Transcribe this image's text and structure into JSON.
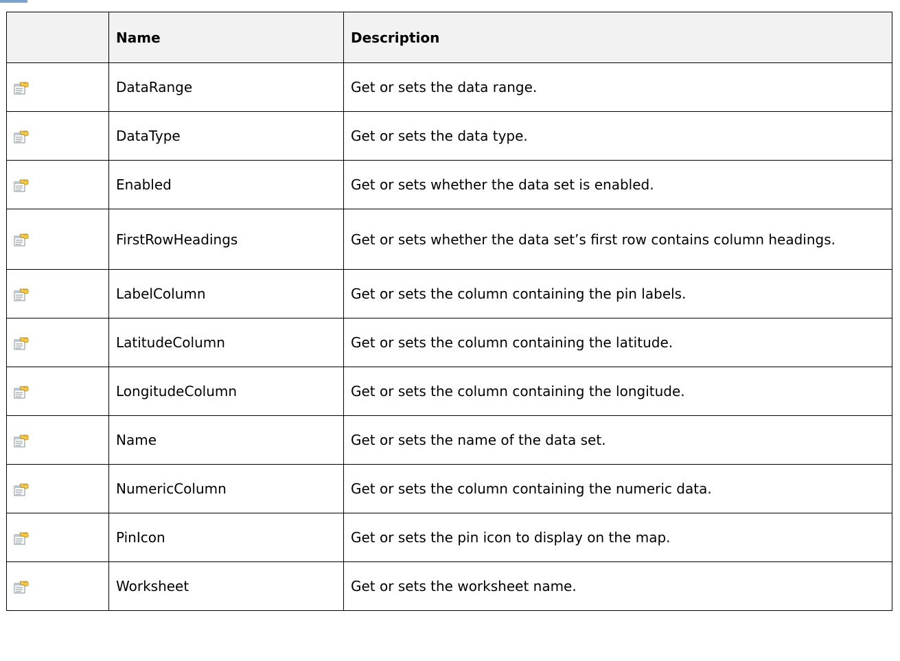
{
  "table": {
    "headers": {
      "icon": "",
      "name": "Name",
      "description": "Description"
    },
    "rows": [
      {
        "icon": "property-icon",
        "name": "DataRange",
        "description": "Get or sets the data range."
      },
      {
        "icon": "property-icon",
        "name": "DataType",
        "description": "Get or sets the data type."
      },
      {
        "icon": "property-icon",
        "name": "Enabled",
        "description": "Get or sets whether the data set is enabled."
      },
      {
        "icon": "property-icon",
        "name": "FirstRowHeadings",
        "description": "Get or sets whether the data set’s first row contains column headings."
      },
      {
        "icon": "property-icon",
        "name": "LabelColumn",
        "description": "Get or sets the column containing the pin labels."
      },
      {
        "icon": "property-icon",
        "name": "LatitudeColumn",
        "description": "Get or sets the column containing the latitude."
      },
      {
        "icon": "property-icon",
        "name": "LongitudeColumn",
        "description": "Get or sets the column containing the longitude."
      },
      {
        "icon": "property-icon",
        "name": "Name",
        "description": "Get or sets the name of the data set."
      },
      {
        "icon": "property-icon",
        "name": "NumericColumn",
        "description": "Get or sets the column containing the numeric data."
      },
      {
        "icon": "property-icon",
        "name": "PinIcon",
        "description": "Get or sets the pin icon to display on the map."
      },
      {
        "icon": "property-icon",
        "name": "Worksheet",
        "description": "Get or sets the worksheet name."
      }
    ]
  },
  "colors": {
    "header_text": "#6b6b6b",
    "header_bg": "#f2f2f2",
    "border": "#000000",
    "accent": "#4f81bd"
  }
}
